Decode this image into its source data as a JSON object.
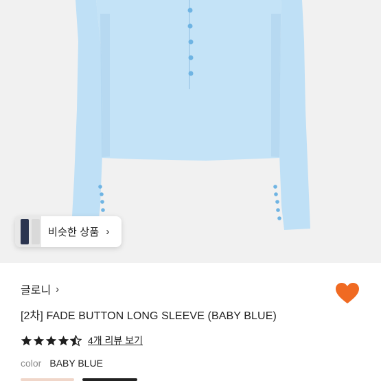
{
  "hero": {
    "image_description": "baby blue long sleeve button top",
    "colors": {
      "background": "#f1f1f1",
      "garment": "#bfe0f6",
      "garment_shadow": "#a9d0ec",
      "buttons": "#6fb4e3"
    },
    "similar_products": {
      "label": "비슷한 상품",
      "chevron": "›"
    }
  },
  "product": {
    "brand": "글로니",
    "brand_chevron": "›",
    "title": "[2차] FADE BUTTON LONG SLEEVE (BABY BLUE)",
    "rating": 4.5,
    "review_link": "4개 리뷰 보기",
    "option": {
      "key": "color",
      "value": "BABY BLUE"
    }
  },
  "actions": {
    "like_icon": "heart-icon",
    "like_color": "#f06a22"
  }
}
